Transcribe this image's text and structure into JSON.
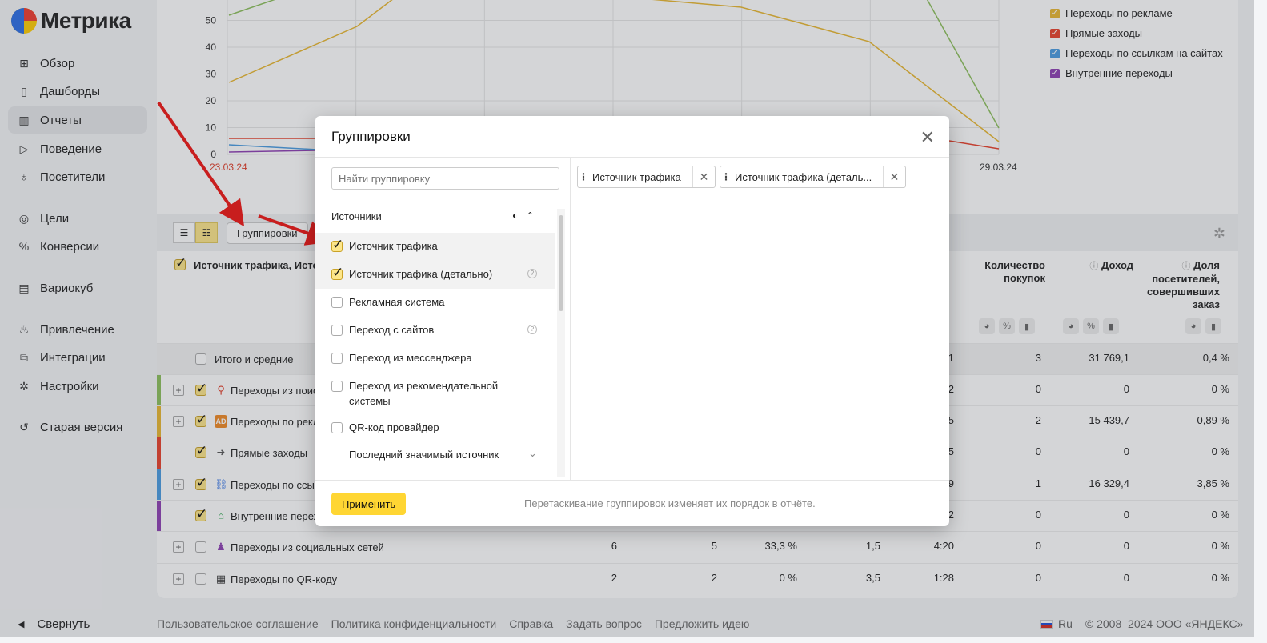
{
  "app": {
    "logo_text": "Метрика"
  },
  "sidebar": {
    "items": [
      {
        "label": "Обзор",
        "icon": "grid-icon"
      },
      {
        "label": "Дашборды",
        "icon": "dashboard-icon"
      },
      {
        "label": "Отчеты",
        "icon": "chart-icon",
        "active": true
      },
      {
        "label": "Поведение",
        "icon": "play-icon"
      },
      {
        "label": "Посетители",
        "icon": "person-icon"
      },
      {
        "label": "Цели",
        "icon": "target-icon"
      },
      {
        "label": "Конверсии",
        "icon": "percent-icon"
      },
      {
        "label": "Вариокуб",
        "icon": "cube-icon"
      },
      {
        "label": "Привлечение",
        "icon": "flame-icon"
      },
      {
        "label": "Интеграции",
        "icon": "puzzle-icon"
      },
      {
        "label": "Настройки",
        "icon": "gear-icon"
      },
      {
        "label": "Старая версия",
        "icon": "undo-icon"
      }
    ],
    "collapse_label": "Свернуть"
  },
  "chart_data": {
    "type": "line",
    "y_ticks": [
      "0",
      "10",
      "20",
      "30",
      "40",
      "50"
    ],
    "x_ticks": [
      "23.03.24",
      "29.03.24"
    ],
    "legend": [
      {
        "name": "Переходы по рекламе",
        "color": "#e8b730"
      },
      {
        "name": "Прямые заходы",
        "color": "#e8412b"
      },
      {
        "name": "Переходы по ссылкам на сайтах",
        "color": "#4a9be0"
      },
      {
        "name": "Внутренние переходы",
        "color": "#8e3fb3"
      }
    ]
  },
  "toolbar": {
    "groupings_label": "Группировки"
  },
  "table": {
    "first_header": "Источник трафика, Исто",
    "headers": [
      {
        "label": "Количество покупок"
      },
      {
        "label": "Доход"
      },
      {
        "label": "Доля посетителей, совершивших заказ"
      }
    ],
    "total_label": "Итого и средние",
    "total_values": [
      "1",
      "3",
      "31 769,1",
      "0,4 %"
    ],
    "rows": [
      {
        "name": "Переходы из поис",
        "c1": "2",
        "c2": "0",
        "c3": "0",
        "c4": "0 %"
      },
      {
        "name": "Переходы по рекл",
        "c1": "5",
        "c2": "2",
        "c3": "15 439,7",
        "c4": "0,89 %"
      },
      {
        "name": "Прямые заходы",
        "c1": "5",
        "c2": "0",
        "c3": "0",
        "c4": "0 %"
      },
      {
        "name": "Переходы по ссыл",
        "c1": "9",
        "c2": "1",
        "c3": "16 329,4",
        "c4": "3,85 %"
      },
      {
        "name": "Внутренние перех",
        "c1": "2",
        "c2": "0",
        "c3": "0",
        "c4": "0 %"
      },
      {
        "name": "Переходы из социальных сетей",
        "v1": "6",
        "v2": "5",
        "v3": "33,3 %",
        "v4": "1,5",
        "v5": "4:20",
        "c2": "0",
        "c3": "0",
        "c4": "0 %"
      },
      {
        "name": "Переходы по QR-коду",
        "v1": "2",
        "v2": "2",
        "v3": "0 %",
        "v4": "3,5",
        "v5": "1:28",
        "c2": "0",
        "c3": "0",
        "c4": "0 %"
      }
    ]
  },
  "modal": {
    "title": "Группировки",
    "search_placeholder": "Найти группировку",
    "section": "Источники",
    "options": [
      {
        "label": "Источник трафика",
        "checked": true
      },
      {
        "label": "Источник трафика (детально)",
        "checked": true
      },
      {
        "label": "Рекламная система",
        "checked": false
      },
      {
        "label": "Переход с сайтов",
        "checked": false
      },
      {
        "label": "Переход из мессенджера",
        "checked": false
      },
      {
        "label": "Переход из рекомендательной системы",
        "checked": false
      },
      {
        "label": "QR-код провайдер",
        "checked": false
      },
      {
        "label": "Последний значимый источник"
      }
    ],
    "selected_chips": [
      "Источник трафика",
      "Источник трафика (деталь..."
    ],
    "apply_label": "Применить",
    "hint": "Перетаскивание группировок изменяет их порядок в отчёте."
  },
  "footer": {
    "links": [
      "Пользовательское соглашение",
      "Политика конфиденциальности",
      "Справка",
      "Задать вопрос",
      "Предложить идею"
    ],
    "lang": "Ru",
    "copyright": "© 2008–2024 ООО «ЯНДЕКС»"
  }
}
